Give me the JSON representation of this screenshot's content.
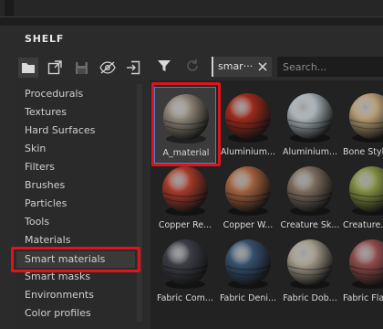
{
  "panel": {
    "title": "SHELF"
  },
  "toolbar": {
    "icons": [
      "folder-icon",
      "export-icon",
      "save-icon",
      "visibility-icon",
      "import-icon"
    ]
  },
  "categories": [
    "Procedurals",
    "Textures",
    "Hard Surfaces",
    "Skin",
    "Filters",
    "Brushes",
    "Particles",
    "Tools",
    "Materials",
    "Smart materials",
    "Smart masks",
    "Environments",
    "Color profiles"
  ],
  "selected_category": "Smart materials",
  "filter": {
    "tag": "smar···",
    "search_placeholder": "Search..."
  },
  "items": [
    {
      "label": "A_material",
      "color": "#8a8174",
      "selected": true
    },
    {
      "label": "Aluminium...",
      "color": "#9b2a1c"
    },
    {
      "label": "Aluminium...",
      "color": "#a9b2b8"
    },
    {
      "label": "Bone Style",
      "color": "#b39a73"
    },
    {
      "label": "Copper Re...",
      "color": "#a33a2a"
    },
    {
      "label": "Copper W...",
      "color": "#a0603c"
    },
    {
      "label": "Creature Sk...",
      "color": "#7a6a5c"
    },
    {
      "label": "Creature...",
      "color": "#7f8a3f"
    },
    {
      "label": "Fabric Com...",
      "color": "#3a3d44"
    },
    {
      "label": "Fabric Deni...",
      "color": "#35506d"
    },
    {
      "label": "Fabric Dob...",
      "color": "#a39b8b"
    },
    {
      "label": "Fabric Fla...",
      "color": "#8c4a4a"
    }
  ],
  "colors": {
    "highlight": "#e0121b",
    "selection_border": "#4a7fd0"
  }
}
